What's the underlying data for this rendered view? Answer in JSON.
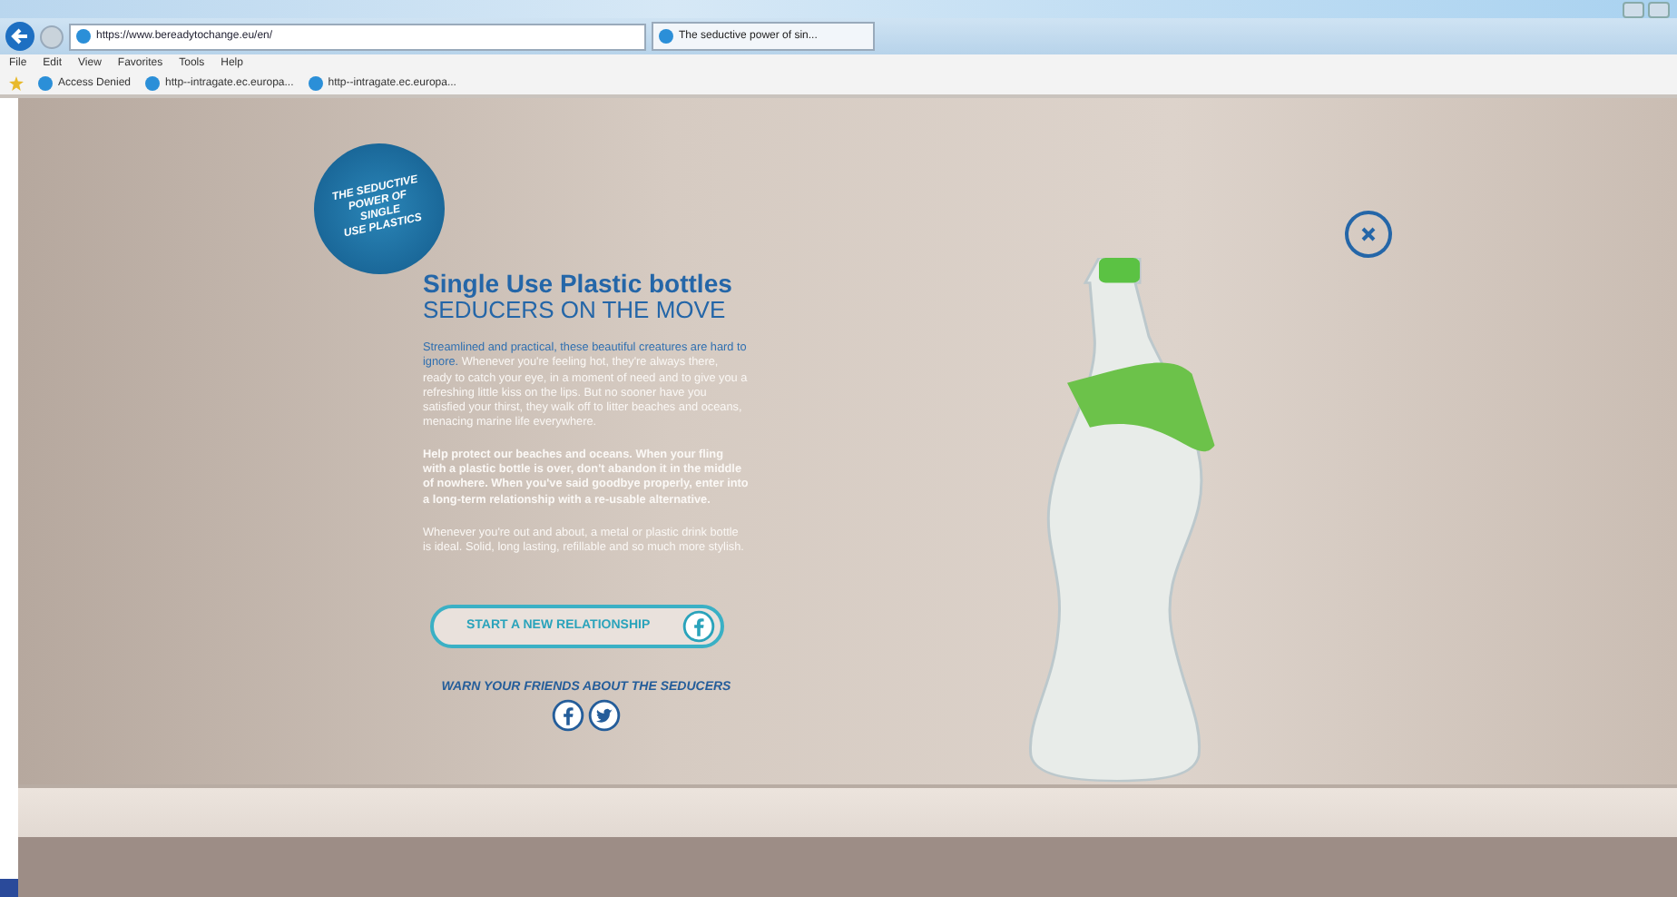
{
  "browser": {
    "address": "https://www.bereadytochange.eu/en/",
    "tab_title": "The seductive power of sin...",
    "menu": [
      "File",
      "Edit",
      "View",
      "Favorites",
      "Tools",
      "Help"
    ],
    "favorites": [
      "Access Denied",
      "http--intragate.ec.europa...",
      "http--intragate.ec.europa..."
    ]
  },
  "page": {
    "badge_lines": [
      "THE SEDUCTIVE",
      "POWER OF",
      "SINGLE",
      "USE PLASTICS"
    ],
    "title": "Single Use Plastic bottles",
    "subtitle": "SEDUCERS ON THE MOVE",
    "intro_lead": "Streamlined and practical, these beautiful creatures are hard to ignore.",
    "intro_rest": "Whenever you're feeling hot, they're always there, ready to catch your eye, in a moment of need and to give you a refreshing little kiss on the lips. But no sooner have you satisfied your thirst, they walk off to litter beaches and oceans, menacing marine life everywhere.",
    "call_to_action": "Help protect our beaches and oceans. When your fling with a plastic bottle is over, don't abandon it in the middle of nowhere. When you've said goodbye properly, enter into a long-term relationship with a re-usable alternative.",
    "tip": "Whenever you're out and about, a metal or plastic drink bottle is ideal. Solid, long lasting, refillable and so much more stylish.",
    "button": "START A NEW RELATIONSHIP",
    "share_label": "WARN YOUR FRIENDS ABOUT THE SEDUCERS"
  }
}
